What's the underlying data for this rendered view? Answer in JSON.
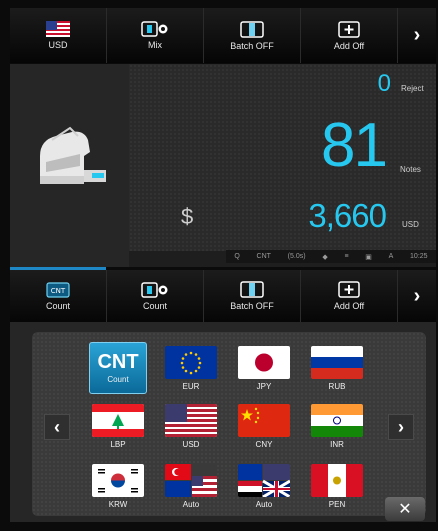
{
  "toolbar": {
    "buttons": [
      {
        "label": "USD",
        "icon": "us-flag-icon"
      },
      {
        "label": "Mix",
        "icon": "mix-gear-icon"
      },
      {
        "label": "Batch OFF",
        "icon": "batch-icon"
      },
      {
        "label": "Add Off",
        "icon": "add-icon"
      }
    ],
    "next_icon": "chevron-right-icon",
    "next_glyph": "›"
  },
  "display": {
    "reject_value": "0",
    "reject_label": "Reject",
    "notes_value": "81",
    "notes_label": "Notes",
    "amount_value": "3,660",
    "amount_unit": "USD",
    "currency_symbol": "$",
    "accent_color": "#27c8f0"
  },
  "statusbar": {
    "items": [
      "Q",
      "CNT",
      "(5.0s)",
      "◆",
      "≡",
      "▣",
      "A",
      "10:25"
    ]
  },
  "toolbar2": {
    "buttons": [
      {
        "label": "Count",
        "icon": "cnt-icon"
      },
      {
        "label": "Count",
        "icon": "mix-gear-icon"
      },
      {
        "label": "Batch OFF",
        "icon": "batch-icon"
      },
      {
        "label": "Add Off",
        "icon": "add-icon"
      }
    ],
    "next_glyph": "›"
  },
  "currency_panel": {
    "count_tile": {
      "big": "CNT",
      "label": "Count"
    },
    "tiles": [
      {
        "code": "EUR"
      },
      {
        "code": "JPY"
      },
      {
        "code": "RUB"
      },
      {
        "code": "LBP"
      },
      {
        "code": "USD"
      },
      {
        "code": "CNY"
      },
      {
        "code": "INR"
      },
      {
        "code": "KRW"
      },
      {
        "code": "Auto"
      },
      {
        "code": "Auto"
      },
      {
        "code": "PEN"
      }
    ],
    "prev_glyph": "‹",
    "next_glyph": "›",
    "close_glyph": "✕"
  }
}
